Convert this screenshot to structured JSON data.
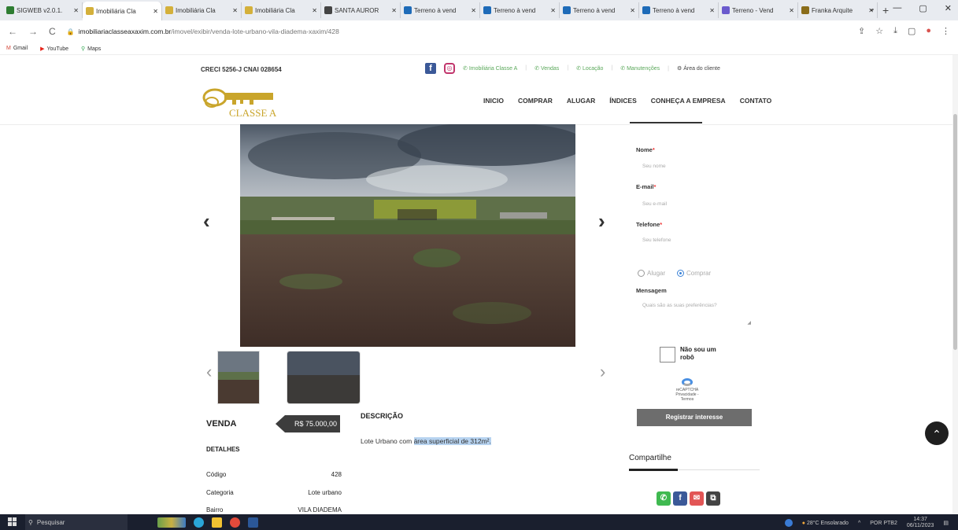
{
  "browser": {
    "tabs": [
      {
        "title": "SIGWEB v2.0.1.",
        "color": "#2e7d32"
      },
      {
        "title": "Imobiliária Cla",
        "color": "#d4b03a",
        "active": true
      },
      {
        "title": "Imobiliária Cla",
        "color": "#d4b03a"
      },
      {
        "title": "Imobiliária Cla",
        "color": "#d4b03a"
      },
      {
        "title": "SANTA AUROR",
        "color": "#444444"
      },
      {
        "title": "Terreno à vend",
        "color": "#1e6bb8"
      },
      {
        "title": "Terreno à vend",
        "color": "#1e6bb8"
      },
      {
        "title": "Terreno à vend",
        "color": "#1e6bb8"
      },
      {
        "title": "Terreno à vend",
        "color": "#1e6bb8"
      },
      {
        "title": "Terreno - Vend",
        "color": "#6a5acd"
      },
      {
        "title": "Franka Arquite",
        "color": "#8a6d1a"
      }
    ],
    "new_tab": "+",
    "window_controls": [
      "⌄",
      "—",
      "▢",
      "✕"
    ],
    "nav": [
      "←",
      "→",
      "C"
    ],
    "url_host": "imobiliariaclasseaxaxim.com.br",
    "url_path": "/imovel/exibir/venda-lote-urbano-vila-diadema-xaxim/428",
    "url_right": [
      "⇪",
      "☆",
      "⤓",
      "▢",
      "●",
      "⋮"
    ],
    "bookmarks": [
      {
        "label": "Gmail",
        "icon": "M",
        "color": "#d44638"
      },
      {
        "label": "YouTube",
        "icon": "▶",
        "color": "#e62117"
      },
      {
        "label": "Maps",
        "icon": "⚲",
        "color": "#34a853"
      }
    ]
  },
  "site": {
    "creci": "CRECI 5256-J    CNAI 028654",
    "social_links": [
      "Imobiliária Classe A",
      "Vendas",
      "Locação",
      "Manutenções"
    ],
    "client_area": "Área do cliente",
    "logo_text": "CLASSE A",
    "nav": [
      "INICIO",
      "COMPRAR",
      "ALUGAR",
      "ÍNDICES",
      "CONHEÇA A EMPRESA",
      "CONTATO"
    ]
  },
  "listing": {
    "deal": "VENDA",
    "price": "R$ 75.000,00",
    "details_title": "DETALHES",
    "details": [
      {
        "label": "Código",
        "value": "428"
      },
      {
        "label": "Categoria",
        "value": "Lote urbano"
      },
      {
        "label": "Bairro",
        "value": "VILA DIADEMA"
      }
    ],
    "description_title": "DESCRIÇÃO",
    "description_plain": "Lote Urbano com ",
    "description_highlight": "área superficial de 312m²."
  },
  "form": {
    "nome_label": "Nome",
    "nome_placeholder": "Seu nome",
    "email_label": "E-mail",
    "email_placeholder": "Seu e-mail",
    "telefone_label": "Telefone",
    "telefone_placeholder": "Seu telefone",
    "required_mark": "*",
    "radio_alugar": "Alugar",
    "radio_comprar": "Comprar",
    "mensagem_label": "Mensagem",
    "mensagem_placeholder": "Quais são as suas preferências?",
    "captcha_label": "Não sou um robô",
    "captcha_brand": "reCAPTCHA",
    "captcha_terms": "Privacidade - Termos",
    "submit": "Registrar interesse"
  },
  "share": {
    "title": "Compartilhe",
    "buttons": [
      {
        "icon": "✆",
        "color": "#3fb950"
      },
      {
        "icon": "f",
        "color": "#3b5998"
      },
      {
        "icon": "✉",
        "color": "#e25555"
      },
      {
        "icon": "⧉",
        "color": "#444444"
      }
    ]
  },
  "gallery": {
    "prev": "‹",
    "next": "›"
  },
  "totop": "⌃",
  "taskbar": {
    "search": "Pesquisar",
    "weather": "28°C  Ensolarado",
    "lang": "POR PTB2",
    "time": "14:37",
    "date": "06/11/2023"
  }
}
